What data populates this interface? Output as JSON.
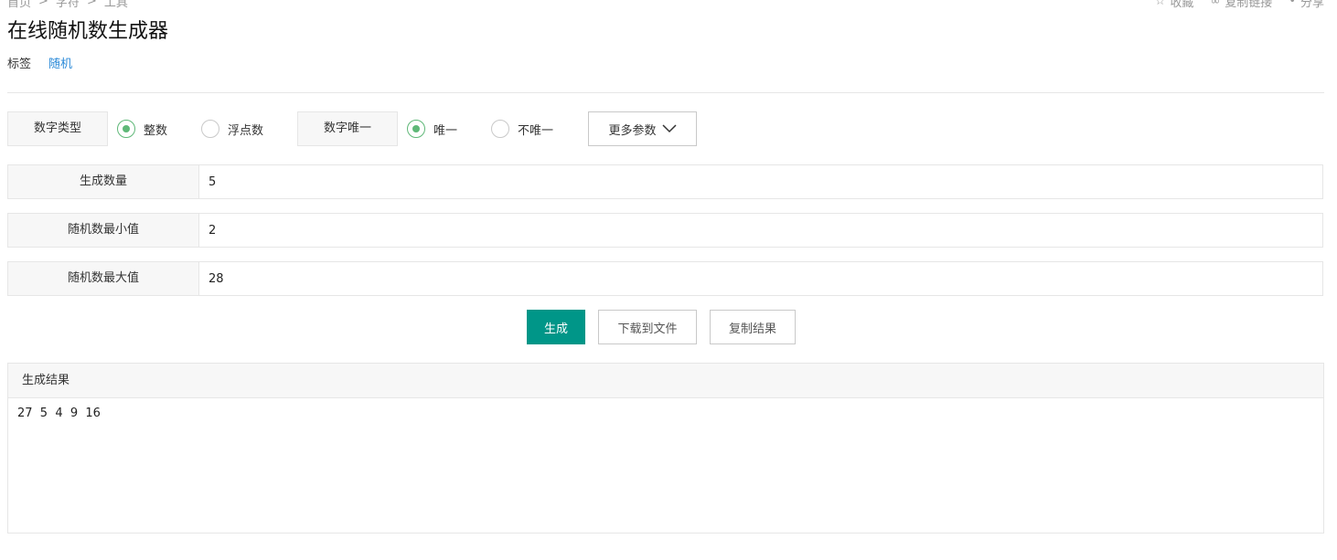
{
  "breadcrumb": {
    "items": [
      "首页",
      "字符",
      "工具"
    ],
    "separator": ">"
  },
  "top_actions": {
    "favorite": "收藏",
    "copy_link": "复制链接",
    "share": "分享"
  },
  "page": {
    "title": "在线随机数生成器"
  },
  "tags": {
    "label": "标签",
    "items": [
      "随机"
    ]
  },
  "options": {
    "number_type": {
      "label": "数字类型",
      "choices": [
        "整数",
        "浮点数"
      ],
      "selected": "整数"
    },
    "unique": {
      "label": "数字唯一",
      "choices": [
        "唯一",
        "不唯一"
      ],
      "selected": "唯一"
    },
    "more_params": "更多参数"
  },
  "fields": {
    "count": {
      "label": "生成数量",
      "value": "5"
    },
    "min": {
      "label": "随机数最小值",
      "value": "2"
    },
    "max": {
      "label": "随机数最大值",
      "value": "28"
    }
  },
  "buttons": {
    "generate": "生成",
    "download": "下载到文件",
    "copy": "复制结果"
  },
  "result": {
    "header": "生成结果",
    "text": "27  5  4  9  16"
  },
  "colors": {
    "primary": "#009688",
    "radio_checked": "#5fb878",
    "link": "#2b8ad8"
  },
  "icons": {
    "favorite": "star-icon",
    "copy_link": "link-icon",
    "share": "share-icon",
    "more": "chevron-down-icon"
  }
}
